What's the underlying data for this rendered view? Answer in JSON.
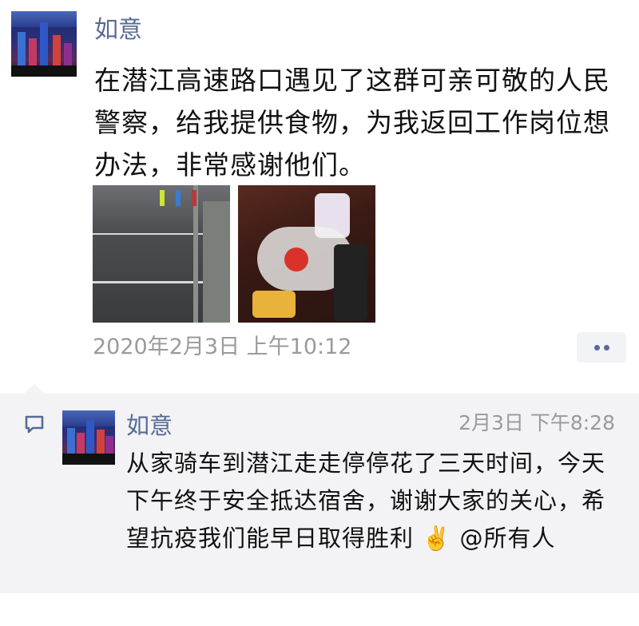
{
  "post": {
    "username": "如意",
    "text": "在潜江高速路口遇见了这群可亲可敬的人民警察，给我提供食物，为我返回工作岗位想办法，非常感谢他们。",
    "timestamp": "2020年2月3日 上午10:12"
  },
  "comment": {
    "username": "如意",
    "time": "2月3日 下午8:28",
    "text": "从家骑车到潜江走走停停花了三天时间，今天下午终于安全抵达宿舍，谢谢大家的关心，希望抗疫我们能早日取得胜利 ✌️ @所有人"
  },
  "colors": {
    "name": "#576b95",
    "meta": "#9a9a9a",
    "comment_bg": "#f3f3f5"
  }
}
